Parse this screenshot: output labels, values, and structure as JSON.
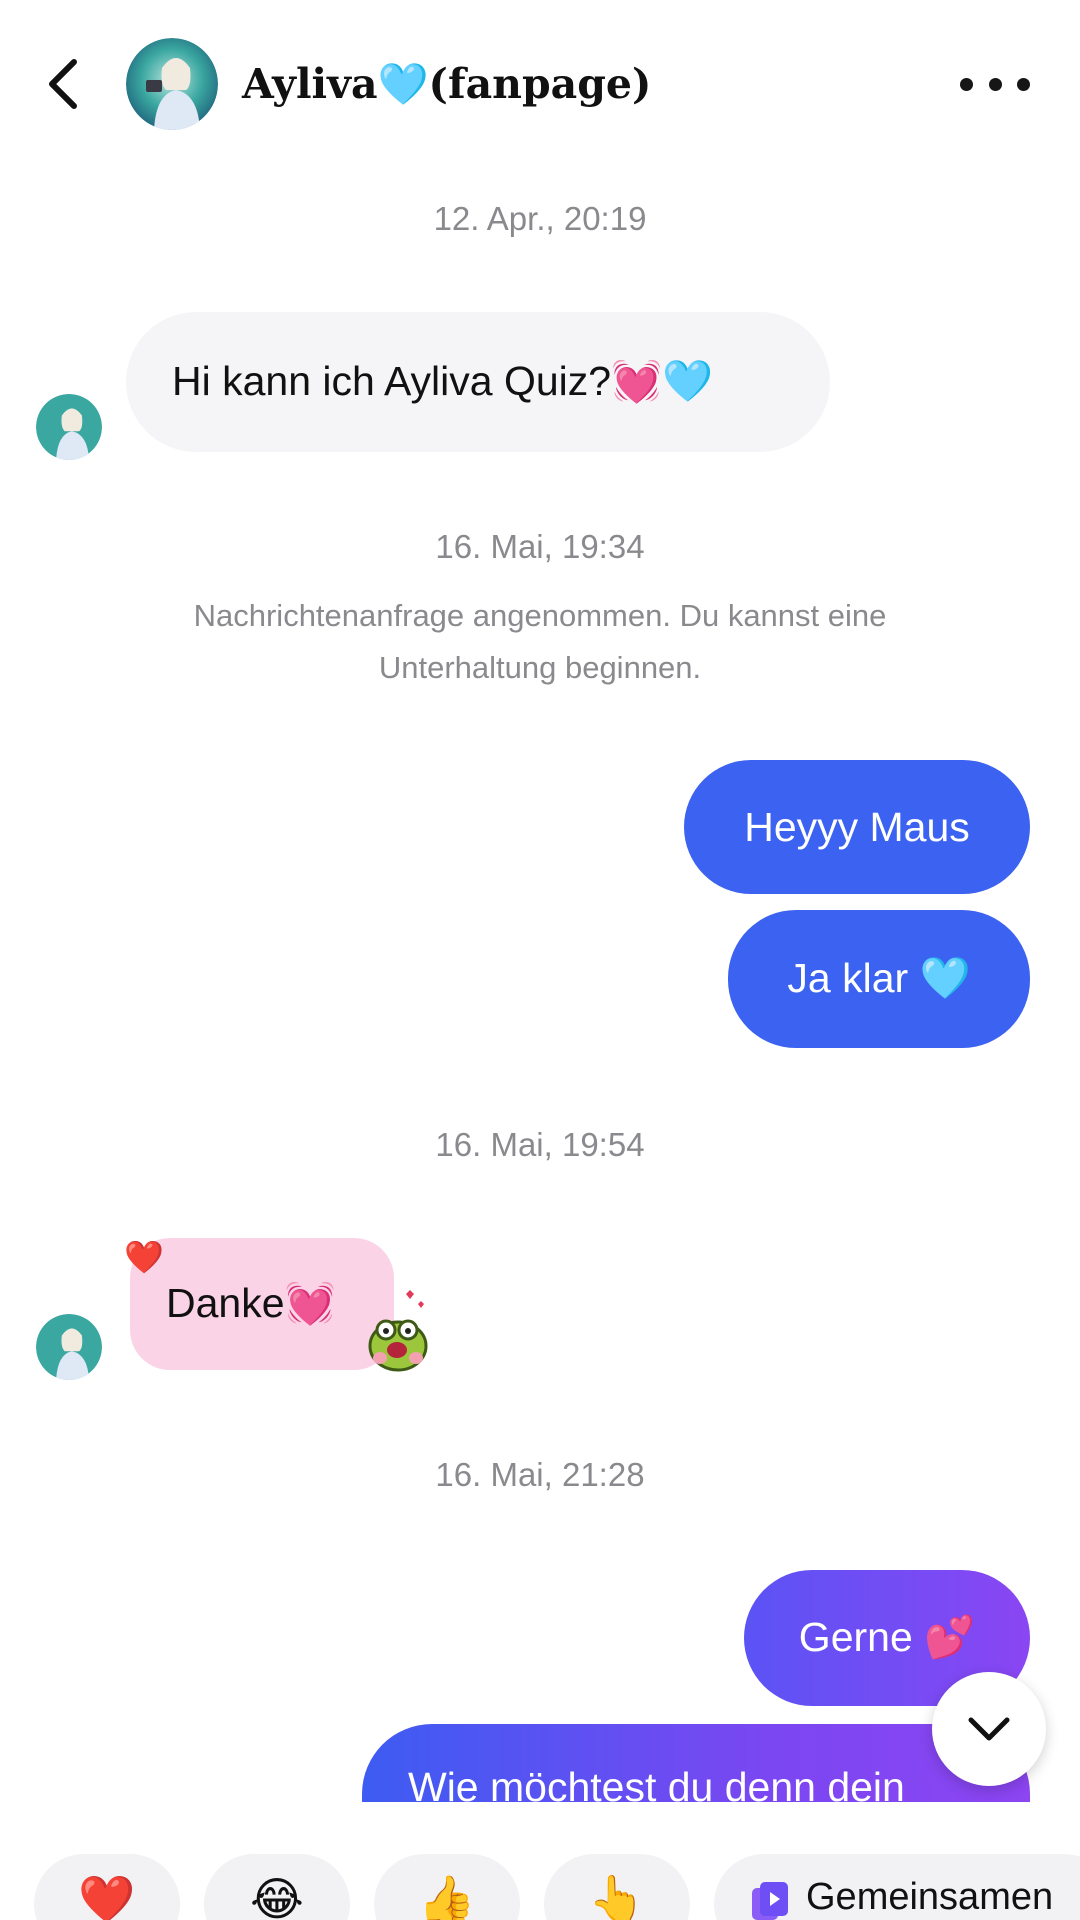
{
  "header": {
    "title": "Ayliva🩵(fanpage)",
    "back_icon": "chevron-left-icon",
    "more_icon": "more-horizontal-icon"
  },
  "messages": [
    {
      "type": "timestamp",
      "text": "12. Apr., 20:19"
    },
    {
      "type": "incoming",
      "text": "Hi kann ich Ayliva Quiz?💓🩵"
    },
    {
      "type": "timestamp",
      "text": "16. Mai, 19:34"
    },
    {
      "type": "system",
      "text": "Nachrichtenanfrage angenommen. Du kannst eine Unterhaltung beginnen."
    },
    {
      "type": "outgoing",
      "text": "Heyyy Maus"
    },
    {
      "type": "outgoing",
      "text": "Ja klar 🩵"
    },
    {
      "type": "timestamp",
      "text": "16. Mai, 19:54"
    },
    {
      "type": "incoming",
      "text": "Danke💓",
      "reaction": "❤️",
      "sticker": "frog-sticker-icon"
    },
    {
      "type": "timestamp",
      "text": "16. Mai, 21:28"
    },
    {
      "type": "outgoing",
      "text": "Gerne 💕"
    },
    {
      "type": "outgoing",
      "text": "Wie möchtest du denn dein"
    }
  ],
  "quick_replies": [
    {
      "emoji": "❤️"
    },
    {
      "emoji": "😂"
    },
    {
      "emoji": "👍"
    },
    {
      "emoji": "👆"
    },
    {
      "icon": "shared-video-icon",
      "label": "Gemeinsamen"
    }
  ],
  "colors": {
    "outgoing_bubble": "#3b62f0",
    "incoming_bubble": "#f5f5f7",
    "pink_bubble": "#fbd3e6",
    "gradient_start": "#5b53f5",
    "gradient_end": "#8a46f3"
  }
}
